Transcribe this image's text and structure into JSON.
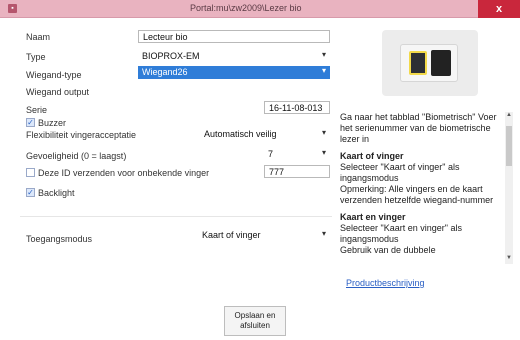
{
  "window": {
    "title": "Portal:mu\\zw2009\\Lezer bio",
    "close_glyph": "x"
  },
  "form": {
    "naam": {
      "label": "Naam",
      "value": "Lecteur bio"
    },
    "type": {
      "label": "Type",
      "value": "BIOPROX-EM"
    },
    "wiegand_type": {
      "label": "Wiegand-type",
      "value": "Wiegand26"
    },
    "wiegand_output": {
      "label": "Wiegand output"
    },
    "serie": {
      "label": "Serie",
      "value": "16-11-08-013"
    },
    "buzzer": {
      "label": "Buzzer",
      "checked": true
    },
    "flexibiliteit": {
      "label": "Flexibiliteit vingeracceptatie",
      "value": "Automatisch veilig"
    },
    "gevoeligheid": {
      "label": "Gevoeligheid (0 = laagst)",
      "value": "7"
    },
    "id_verzenden": {
      "label": "Deze ID verzenden voor onbekende vinger",
      "checked": false,
      "value": "777"
    },
    "backlight": {
      "label": "Backlight",
      "checked": true
    },
    "toegangsmodus": {
      "label": "Toegangsmodus",
      "value": "Kaart of vinger"
    }
  },
  "info": {
    "intro": "Ga naar het tabblad \"Biometrisch\" Voer het serienummer van de biometrische lezer in",
    "s1_title": "Kaart of vinger",
    "s1_text": "Selecteer \"Kaart of vinger\" als ingangsmodus",
    "s1_note": "Opmerking: Alle vingers en de kaart verzenden hetzelfde wiegand-nummer",
    "s2_title": "Kaart en vinger",
    "s2_text": "Selecteer \"Kaart en vinger\" als ingangsmodus",
    "s2_more": "Gebruik van de dubbele"
  },
  "link": {
    "label": "Productbeschrijving"
  },
  "buttons": {
    "save_label": "Opslaan en afsluiten"
  },
  "colors": {
    "titlebar": "#e9b3c0",
    "close": "#c9273c",
    "selection": "#2f7dd8",
    "link": "#2a5fc4"
  }
}
